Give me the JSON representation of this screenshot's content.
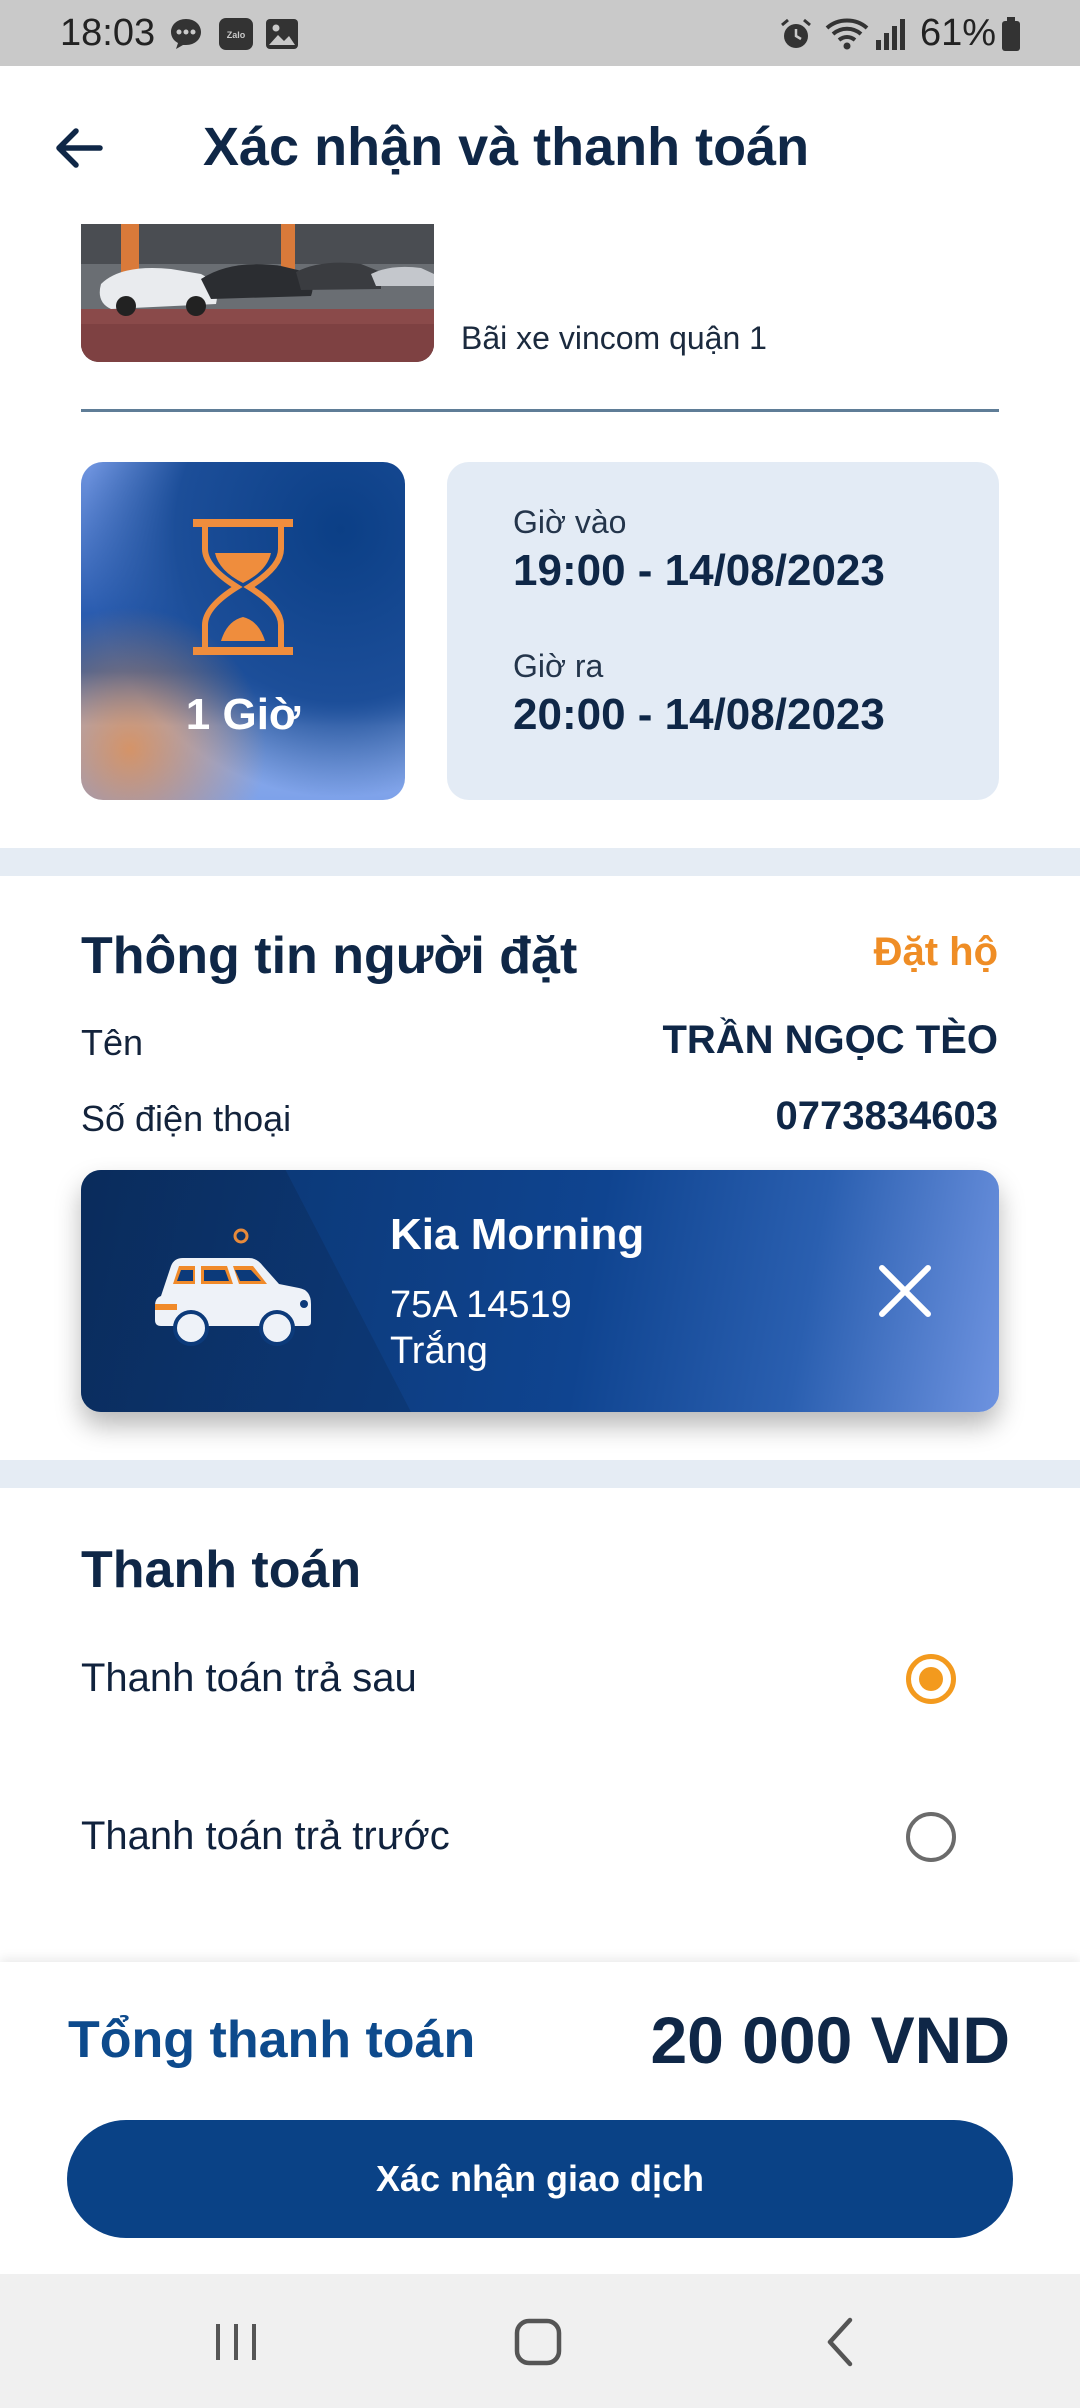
{
  "status_bar": {
    "time": "18:03",
    "battery": "61%",
    "icons": [
      "chat-bubble-icon",
      "zalo-icon",
      "gallery-icon",
      "alarm-icon",
      "wifi-icon",
      "signal-icon",
      "battery-icon"
    ]
  },
  "header": {
    "title": "Xác nhận và thanh toán",
    "back_icon": "arrow-left-icon"
  },
  "parking": {
    "lot_name": "Bãi xe vincom quận 1",
    "duration": "1 Giờ",
    "checkin_label": "Giờ vào",
    "checkin_value": "19:00 - 14/08/2023",
    "checkout_label": "Giờ ra",
    "checkout_value": "20:00 - 14/08/2023"
  },
  "booker": {
    "title": "Thông tin người đặt",
    "proxy_link": "Đặt hộ",
    "name_label": "Tên",
    "name_value": "TRẦN NGỌC TÈO",
    "phone_label": "Số điện thoại",
    "phone_value": "0773834603"
  },
  "vehicle": {
    "name": "Kia Morning",
    "plate": "75A 14519",
    "color": "Trắng"
  },
  "payment": {
    "title": "Thanh toán",
    "options": [
      {
        "label": "Thanh toán trả sau",
        "selected": true
      },
      {
        "label": "Thanh toán trả trước",
        "selected": false
      }
    ]
  },
  "footer": {
    "total_label": "Tổng thanh toán",
    "total_value": "20 000 VND",
    "confirm_label": "Xác nhận giao dịch"
  },
  "colors": {
    "primary": "#0a4286",
    "accent": "#f39a1e",
    "text_dark": "#0f2747",
    "card_bg": "#e3ebf5"
  }
}
